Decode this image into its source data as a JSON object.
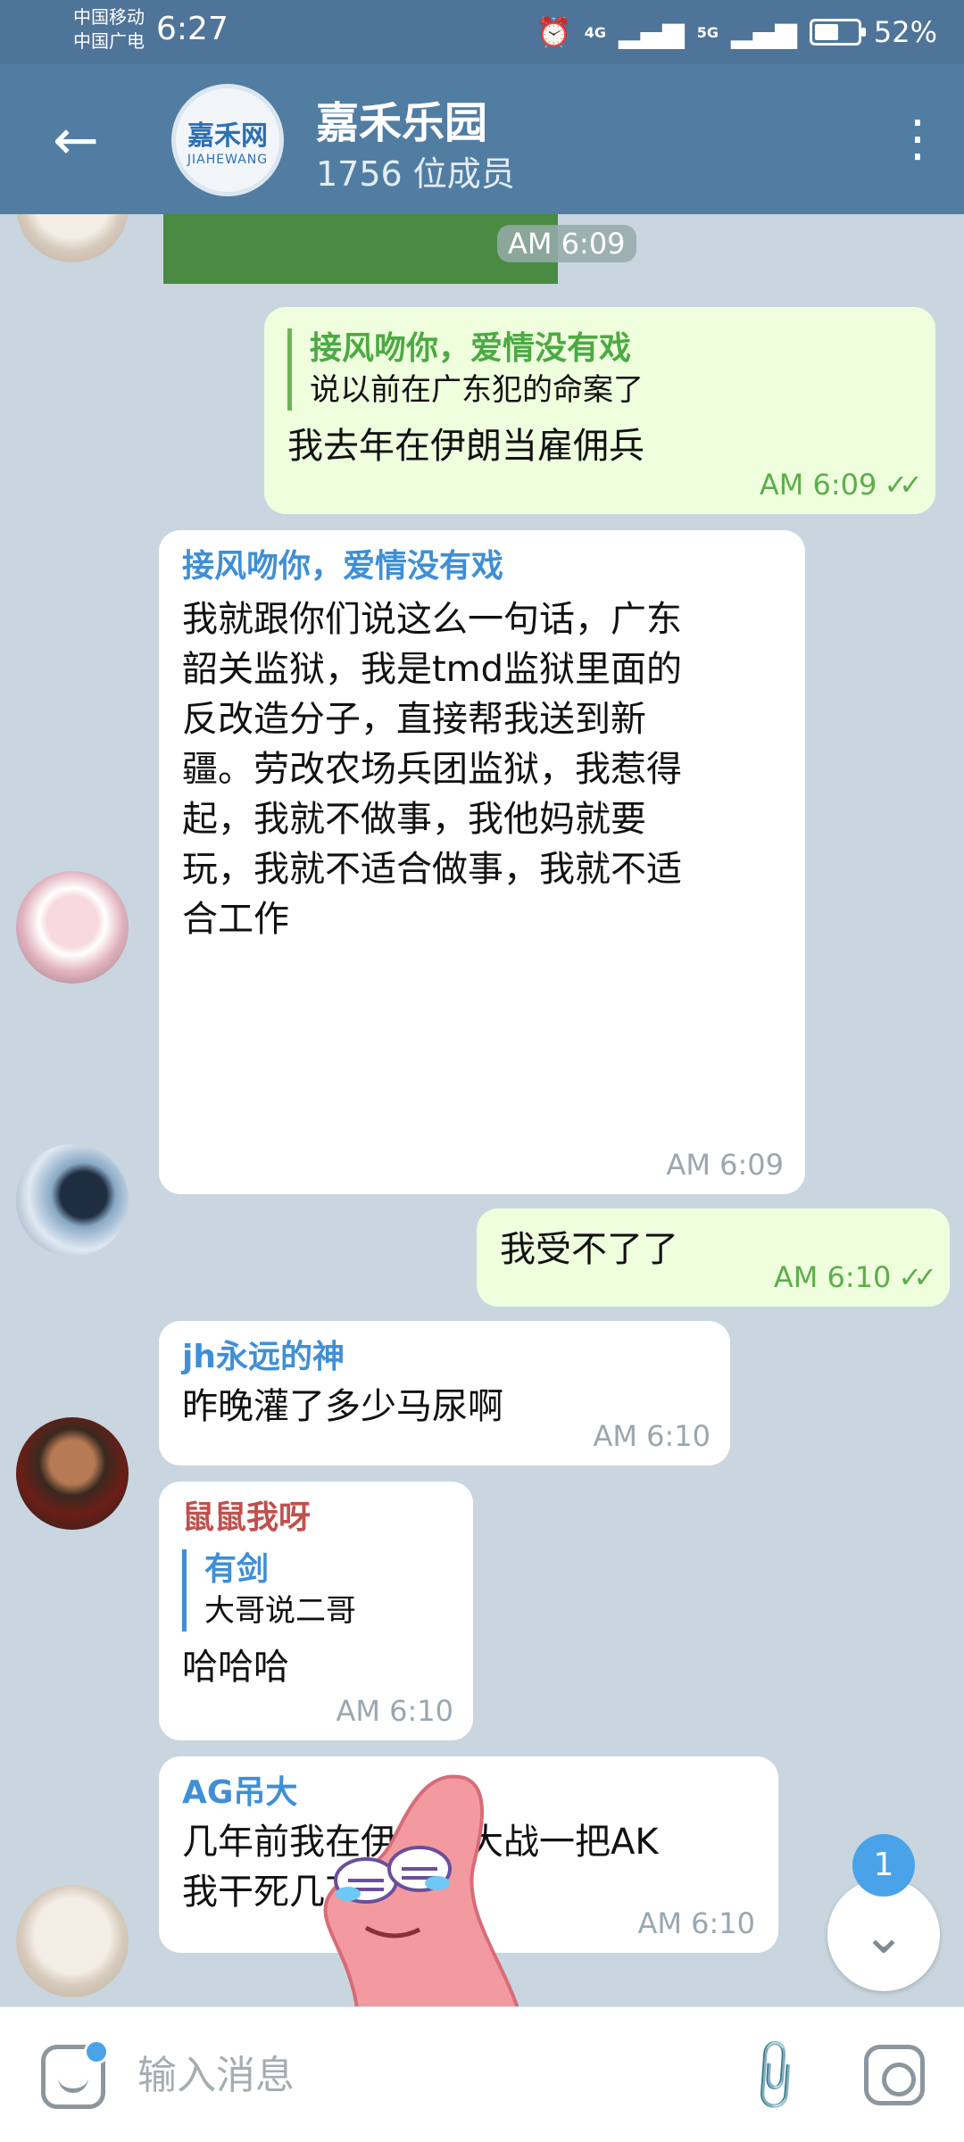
{
  "status_bar": {
    "carrier1": "中国移动",
    "carrier2": "中国广电",
    "time": "6:27",
    "signal1": "4G",
    "signal2": "5G",
    "battery_percent": "52%"
  },
  "header": {
    "back_icon": "arrow-left-icon",
    "group_avatar_top": "嘉禾网",
    "group_avatar_bottom": "JIAHEWANG",
    "title": "嘉禾乐园",
    "members": "1756 位成员",
    "menu_icon": "more-vertical-icon"
  },
  "messages": [
    {
      "type": "media",
      "time": "AM 6:09"
    },
    {
      "type": "outgoing",
      "reply_name": "接风吻你，爱情没有戏",
      "reply_text": "说以前在广东犯的命案了",
      "text": "我去年在伊朗当雇佣兵",
      "time": "AM 6:09",
      "ticks": "✓✓"
    },
    {
      "type": "incoming",
      "name": "接风吻你，爱情没有戏",
      "name_color": "#3f8fd6",
      "lines": [
        "我就跟你们说这么一句话，广东",
        "韶关监狱，我是tmd监狱里面的",
        "反改造分子，直接帮我送到新",
        "疆。劳改农场兵团监狱，我惹得",
        "起，我就不做事，我他妈就要",
        "玩，我就不适合做事，我就不适",
        "合工作"
      ],
      "time": "AM 6:09"
    },
    {
      "type": "outgoing",
      "text": "我受不了了",
      "time": "AM 6:10",
      "ticks": "✓✓"
    },
    {
      "type": "incoming",
      "name": "jh永远的神",
      "name_color": "#3f8fd6",
      "text": "昨晚灌了多少马尿啊",
      "time": "AM 6:10"
    },
    {
      "type": "incoming",
      "name": "鼠鼠我呀",
      "name_color": "#c0504d",
      "reply_name": "有剑",
      "reply_text": "大哥说二哥",
      "text": "哈哈哈",
      "time": "AM 6:10"
    },
    {
      "type": "incoming",
      "name": "AG吊大",
      "name_color": "#3f8fd6",
      "lines": [
        "几年前我在伊拉克大战一把AK",
        "我干死几万人"
      ],
      "time": "AM 6:10"
    }
  ],
  "scroll_button": {
    "icon": "chevron-down-icon",
    "badge": "1"
  },
  "input_bar": {
    "sticker_icon": "sticker-icon",
    "placeholder": "输入消息",
    "attach_icon": "paperclip-icon",
    "camera_icon": "instagram-camera-icon"
  }
}
